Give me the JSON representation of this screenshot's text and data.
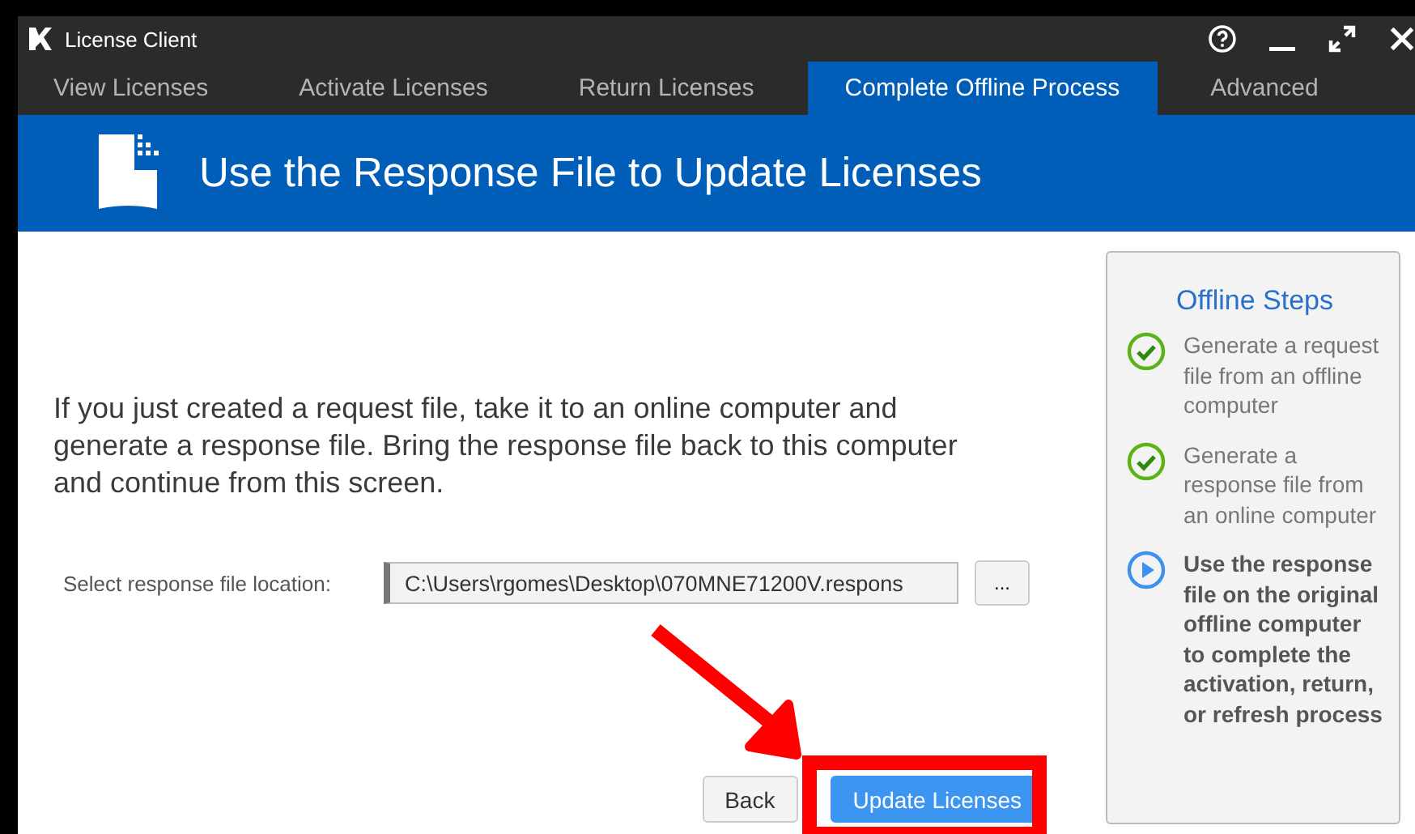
{
  "window": {
    "title": "License Client"
  },
  "tabs": [
    {
      "label": "View Licenses",
      "selected": false
    },
    {
      "label": "Activate Licenses",
      "selected": false
    },
    {
      "label": "Return Licenses",
      "selected": false
    },
    {
      "label": "Complete Offline Process",
      "selected": true
    },
    {
      "label": "Advanced",
      "selected": false
    }
  ],
  "header": {
    "title": "Use the Response File to Update Licenses"
  },
  "instructions": "If you just created a request file, take it to an online computer and generate a response file. Bring the response file back to this computer and continue from this screen.",
  "file_location": {
    "label": "Select response file location:",
    "value": "C:\\Users\\rgomes\\Desktop\\070MNE71200V.respons",
    "browse": "..."
  },
  "buttons": [
    {
      "label": "Back",
      "kind": "secondary"
    },
    {
      "label": "Update Licenses",
      "kind": "primary"
    }
  ],
  "steps_panel": {
    "title": "Offline Steps",
    "steps": [
      {
        "text": "Generate a request file from an offline computer",
        "kind": "done"
      },
      {
        "text": "Generate a response file from an online computer",
        "kind": "done"
      },
      {
        "text": "Use the response file on the original offline computer to complete the activation, return, or refresh process",
        "kind": "current"
      }
    ]
  },
  "annotations": {
    "arrow": true,
    "highlight_box": true
  }
}
